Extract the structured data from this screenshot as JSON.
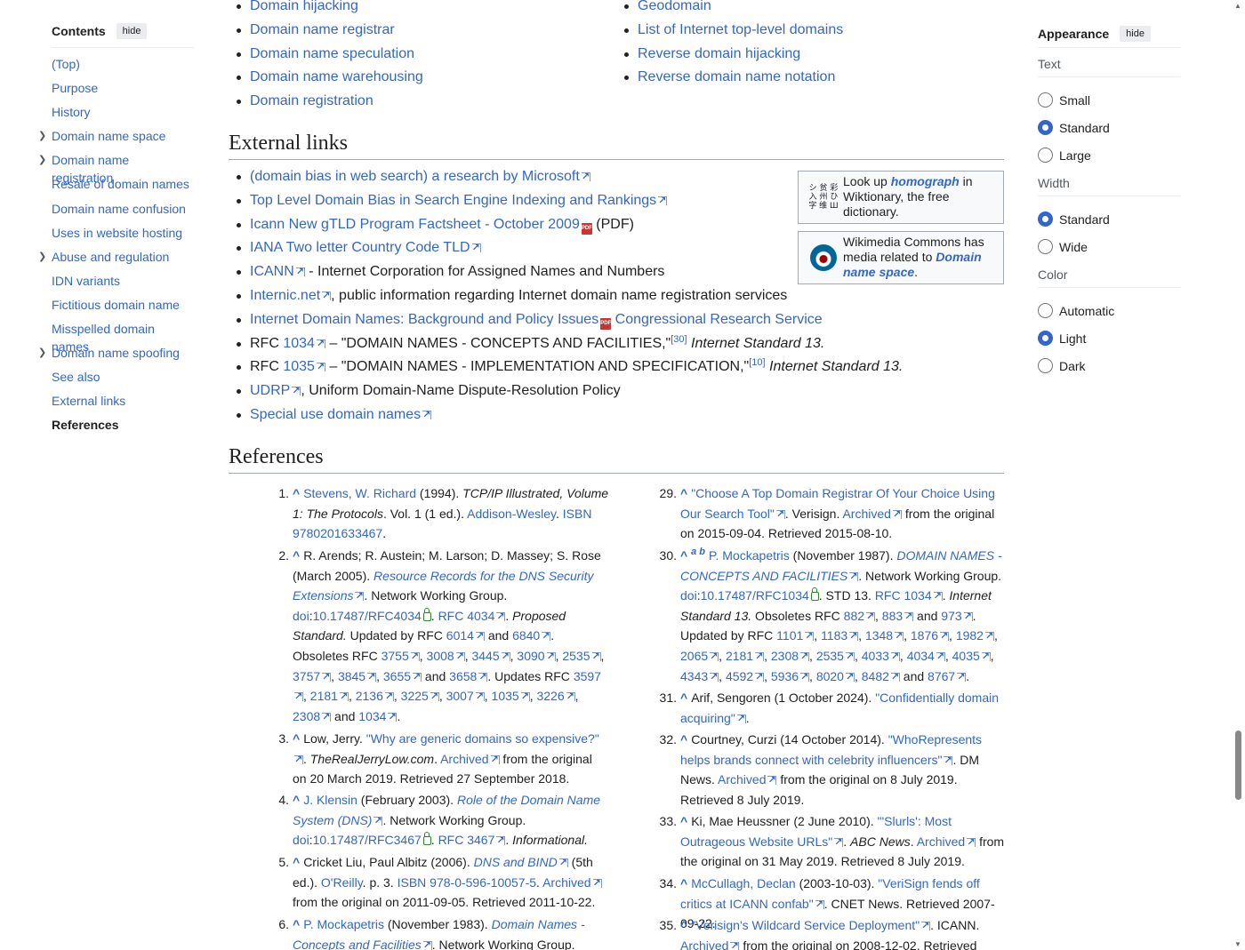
{
  "toc": {
    "title": "Contents",
    "hide": "hide",
    "items": [
      {
        "label": "(Top)",
        "expandable": false
      },
      {
        "label": "Purpose",
        "expandable": false
      },
      {
        "label": "History",
        "expandable": false
      },
      {
        "label": "Domain name space",
        "expandable": true
      },
      {
        "label": "Domain name registration",
        "expandable": true
      },
      {
        "label": "Resale of domain names",
        "expandable": false
      },
      {
        "label": "Domain name confusion",
        "expandable": false
      },
      {
        "label": "Uses in website hosting",
        "expandable": false
      },
      {
        "label": "Abuse and regulation",
        "expandable": true
      },
      {
        "label": "IDN variants",
        "expandable": false
      },
      {
        "label": "Fictitious domain name",
        "expandable": false
      },
      {
        "label": "Misspelled domain names",
        "expandable": false
      },
      {
        "label": "Domain name spoofing",
        "expandable": true
      },
      {
        "label": "See also",
        "expandable": false
      },
      {
        "label": "External links",
        "expandable": false
      },
      {
        "label": "References",
        "expandable": false,
        "current": true
      }
    ]
  },
  "appearance": {
    "title": "Appearance",
    "hide": "hide",
    "text": {
      "title": "Text",
      "options": [
        "Small",
        "Standard",
        "Large"
      ],
      "selected": "Standard"
    },
    "width": {
      "title": "Width",
      "options": [
        "Standard",
        "Wide"
      ],
      "selected": "Standard"
    },
    "color": {
      "title": "Color",
      "options": [
        "Automatic",
        "Light",
        "Dark"
      ],
      "selected": "Light"
    }
  },
  "see_also": {
    "col1": [
      "Domain hijacking",
      "Domain name registrar",
      "Domain name speculation",
      "Domain name warehousing",
      "Domain registration"
    ],
    "col2": [
      "Geodomain",
      "List of Internet top-level domains",
      "Reverse domain hijacking",
      "Reverse domain name notation"
    ]
  },
  "external_links": {
    "heading": "External links",
    "items": {
      "l1": "(domain bias in web search) a research by Microsoft",
      "l2": "Top Level Domain Bias in Search Engine Indexing and Rankings",
      "l3": "Icann New gTLD Program Factsheet - October 2009",
      "l3_suffix": " (PDF)",
      "l4": "IANA Two letter Country Code TLD",
      "l5": "ICANN",
      "l5_suffix": " - Internet Corporation for Assigned Names and Numbers",
      "l6": "Internic.net",
      "l6_suffix": ", public information regarding Internet domain name registration services",
      "l7": "Internet Domain Names: Background and Policy Issues",
      "l7_b": "Congressional Research Service",
      "l8_pre": "RFC ",
      "l8_link": "1034",
      "l8_mid": " – \"DOMAIN NAMES - CONCEPTS AND FACILITIES,\"",
      "l8_sup": "[30]",
      "l8_end": " Internet Standard 13.",
      "l9_pre": "RFC ",
      "l9_link": "1035",
      "l9_mid": " – \"DOMAIN NAMES - IMPLEMENTATION AND SPECIFICATION,\"",
      "l9_sup": "[10]",
      "l9_end": " Internet Standard 13.",
      "l10": "UDRP",
      "l10_suffix": ", Uniform Domain-Name Dispute-Resolution Policy",
      "l11": "Special use domain names"
    },
    "wiktionary": {
      "pre": "Look up ",
      "term": "homograph",
      "post": " in Wiktionary, the free dictionary.",
      "icon": "シ 贫 彩 入 州 ひ 字 维 Ш"
    },
    "commons": {
      "pre": "Wikimedia Commons has media related to ",
      "term": "Domain name space",
      "post": "."
    }
  },
  "references": {
    "heading": "References"
  }
}
